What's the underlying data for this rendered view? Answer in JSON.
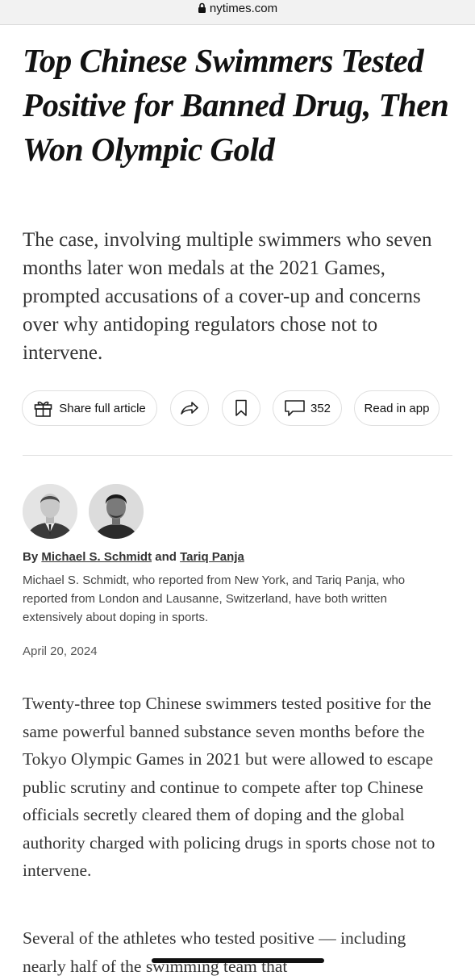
{
  "browser": {
    "url": "nytimes.com",
    "lock_icon": "lock-icon"
  },
  "article": {
    "headline": "Top Chinese Swimmers Tested Positive for Banned Drug, Then Won Olympic Gold",
    "summary": "The case, involving multiple swimmers who seven months later won medals at the 2021 Games, prompted accusations of a cover-up and concerns over why antidoping regulators chose not to intervene.",
    "actions": {
      "share_label": "Share full article",
      "share_icon": "gift-icon",
      "forward_icon": "share-arrow-icon",
      "bookmark_icon": "bookmark-icon",
      "comments_icon": "comment-icon",
      "comments_count": "352",
      "read_in_app_label": "Read in app"
    },
    "byline": {
      "prefix": "By",
      "author1": "Michael S. Schmidt",
      "conjunction": "and",
      "author2": "Tariq Panja",
      "bio": "Michael S. Schmidt, who reported from New York, and Tariq Panja, who reported from London and Lausanne, Switzerland, have both written extensively about doping in sports."
    },
    "date": "April 20, 2024",
    "paragraphs": [
      "Twenty-three top Chinese swimmers tested positive for the same powerful banned substance seven months before the Tokyo Olympic Games in 2021 but were allowed to escape public scrutiny and continue to compete after top Chinese officials secretly cleared them of doping and the global authority charged with policing drugs in sports chose not to intervene.",
      "Several of the athletes who tested positive — including nearly half of the swimming team that"
    ]
  }
}
